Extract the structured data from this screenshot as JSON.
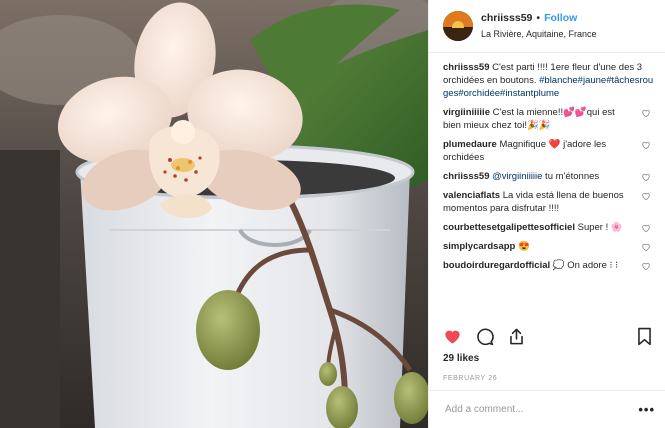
{
  "header": {
    "username": "chriisss59",
    "separator": "•",
    "follow_label": "Follow",
    "location": "La Rivière, Aquitaine, France"
  },
  "caption": {
    "username": "chriisss59",
    "text": "C'est parti !!!! 1ere fleur d'une des 3 orchidées en boutons.",
    "hashtags": "#blanche#jaune#tâchesrouges#orchidée#instantplume"
  },
  "comments": [
    {
      "username": "virgiiniiiiie",
      "text": "C'est la mienne!!💕💕qui est bien mieux chez toi!🎉🎉"
    },
    {
      "username": "plumedaure",
      "text": "Magnifique ❤️ j'adore les orchidées"
    },
    {
      "username": "chriisss59",
      "mention": "@virgiiniiiiie",
      "text": " tu m'étonnes"
    },
    {
      "username": "valenciaflats",
      "text": "La vida está llena de buenos momentos para disfrutar !!!!"
    },
    {
      "username": "courbettesetgalipettesofficiel",
      "text": "Super ! 🌸"
    },
    {
      "username": "simplycardsapp",
      "text": "😍"
    },
    {
      "username": "boudoirduregardofficial",
      "text": "💭 On adore ⁝ ⁝"
    }
  ],
  "actions": {
    "like_icon": "heart-filled-icon",
    "comment_icon": "speech-bubble-icon",
    "share_icon": "share-icon",
    "save_icon": "bookmark-icon"
  },
  "likes": "29 likes",
  "date": "FEBRUARY 26",
  "add_comment": {
    "placeholder": "Add a comment...",
    "more_label": "•••"
  },
  "colors": {
    "accent": "#3897f0",
    "like_red": "#ed4956",
    "hashtag": "#003569",
    "muted": "#999999"
  }
}
